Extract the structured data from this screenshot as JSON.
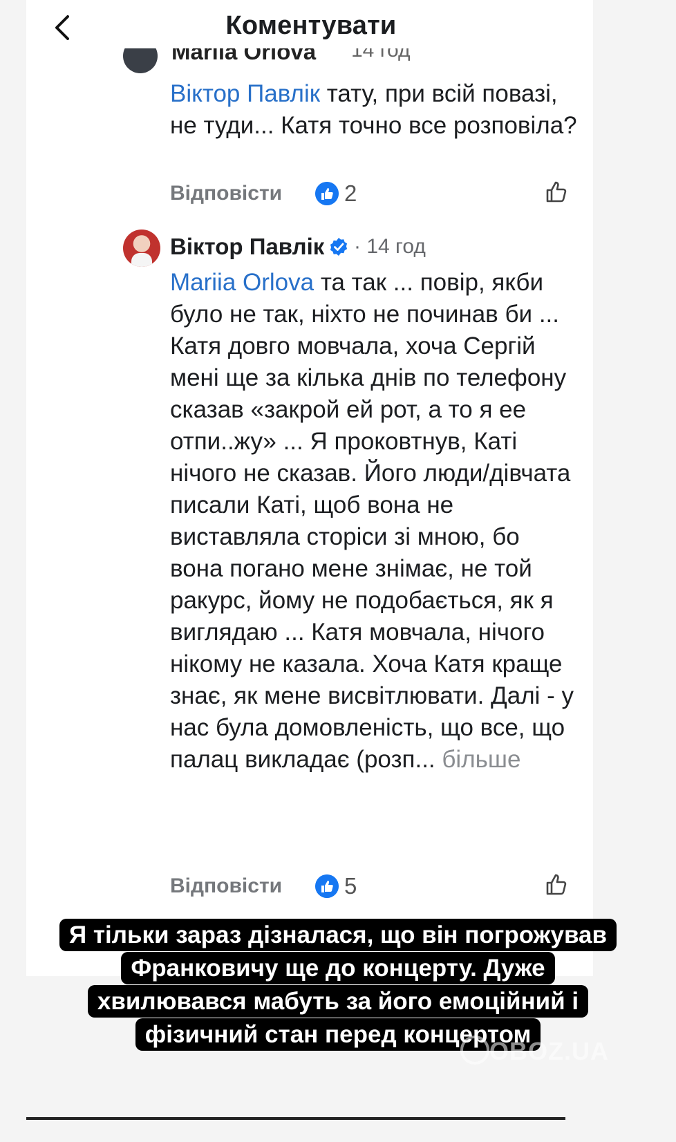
{
  "header": {
    "title": "Коментувати"
  },
  "comment_1": {
    "author_cut": "Mariia Orlova",
    "time_cut": "14 год",
    "mention": "Віктор Павлік",
    "text": " тату, при всій повазі, не туди... Катя точно все розповіла?",
    "reply_label": "Відповісти",
    "likes": "2"
  },
  "comment_2": {
    "author": "Віктор Павлік",
    "time": "· 14 год",
    "mention": "Mariia Orlova",
    "text": " та так ... повір, якби було не так, ніхто не починав би ... Катя довго мовчала, хоча Сергій мені ще за кілька днів по телефону сказав «закрой ей рот, а то я ее отпи..жу» ... Я проковтнув, Каті нічого не сказав. Його люди/дівчата писали Каті, щоб вона не виставляла сторіси зі мною, бо вона погано мене знімає, не той ракурс, йому не подобається, як я виглядаю ... Катя мовчала, нічого нікому не казала. Хоча Катя краще знає, як мене висвітлювати. Далі - у нас була домовленість, що все, що палац викладає (розп...",
    "more": " більше",
    "reply_label": "Відповісти",
    "likes": "5"
  },
  "caption": {
    "line1": "Я тільки зараз дізналася, що він погрожував",
    "line2": "Франковичу ще до концерту. Дуже",
    "line3": "хвилювався мабуть за його емоційний і",
    "line4": "фізичний стан перед концертом"
  },
  "watermark": "OBOZ.UA",
  "colors": {
    "mention": "#2870c9",
    "like_badge": "#1677f2",
    "caption_bg": "#000000"
  }
}
